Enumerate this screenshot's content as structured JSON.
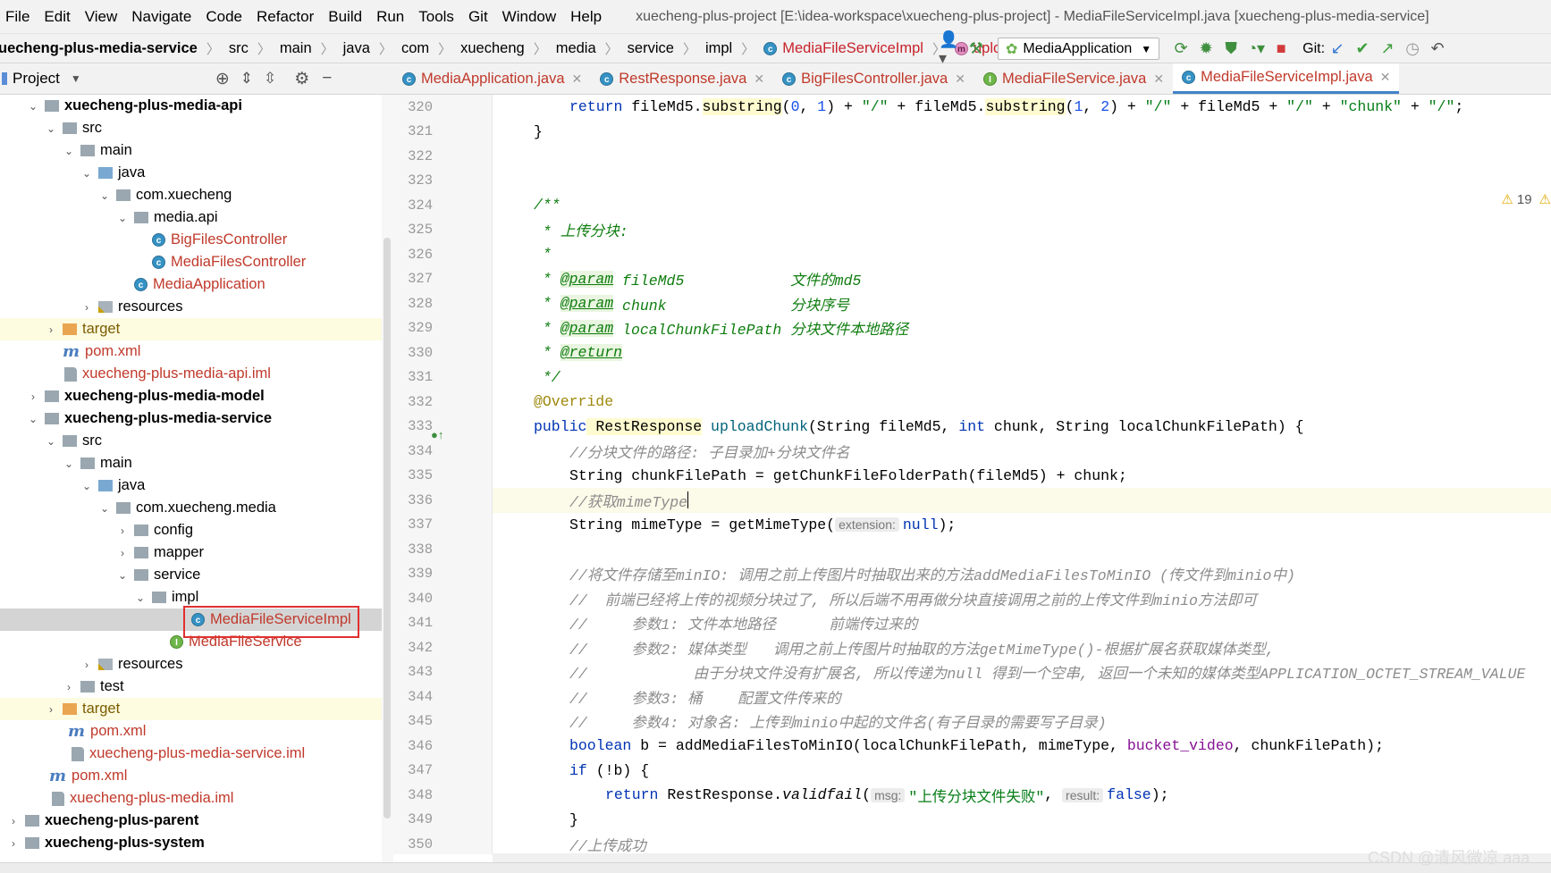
{
  "menubar": {
    "items": [
      "File",
      "Edit",
      "View",
      "Navigate",
      "Code",
      "Refactor",
      "Build",
      "Run",
      "Tools",
      "Git",
      "Window",
      "Help"
    ],
    "window_title": "xuecheng-plus-project [E:\\idea-workspace\\xuecheng-plus-project] - MediaFileServiceImpl.java [xuecheng-plus-media-service]"
  },
  "breadcrumb": {
    "items": [
      "uecheng-plus-media-service",
      "src",
      "main",
      "java",
      "com",
      "xuecheng",
      "media",
      "service",
      "impl",
      "MediaFileServiceImpl",
      "uploadChunk"
    ]
  },
  "toolbar": {
    "run_config": "MediaApplication",
    "git_label": "Git:"
  },
  "sidebar": {
    "title": "Project"
  },
  "tabs": [
    {
      "label": "MediaApplication.java",
      "icon": "class-icon"
    },
    {
      "label": "RestResponse.java",
      "icon": "class-icon"
    },
    {
      "label": "BigFilesController.java",
      "icon": "class-icon"
    },
    {
      "label": "MediaFileService.java",
      "icon": "interface-icon"
    },
    {
      "label": "MediaFileServiceImpl.java",
      "icon": "class-icon",
      "active": true
    }
  ],
  "tree": {
    "r0": "xuecheng-plus-media-api",
    "r1": "src",
    "r2": "main",
    "r3": "java",
    "r4": "com.xuecheng",
    "r5": "media.api",
    "r6": "BigFilesController",
    "r7": "MediaFilesController",
    "r8": "MediaApplication",
    "r9": "resources",
    "r10": "target",
    "r11": "pom.xml",
    "r12": "xuecheng-plus-media-api.iml",
    "r13": "xuecheng-plus-media-model",
    "r14": "xuecheng-plus-media-service",
    "r15": "src",
    "r16": "main",
    "r17": "java",
    "r18": "com.xuecheng.media",
    "r19": "config",
    "r20": "mapper",
    "r21": "service",
    "r22": "impl",
    "r23": "MediaFileServiceImpl",
    "r24": "MediaFileService",
    "r25": "resources",
    "r26": "test",
    "r27": "target",
    "r28": "pom.xml",
    "r29": "xuecheng-plus-media-service.iml",
    "r30": "pom.xml",
    "r31": "xuecheng-plus-media.iml",
    "r32": "xuecheng-plus-parent",
    "r33": "xuecheng-plus-system"
  },
  "editor": {
    "line_numbers": [
      "320",
      "321",
      "322",
      "323",
      "324",
      "325",
      "326",
      "327",
      "328",
      "329",
      "330",
      "331",
      "332",
      "333",
      "334",
      "335",
      "336",
      "337",
      "338",
      "339",
      "340",
      "341",
      "342",
      "343",
      "344",
      "345",
      "346",
      "347",
      "348",
      "349",
      "350"
    ],
    "warnings": "19",
    "code": {
      "l320a": "return",
      "l320b": " fileMd5.",
      "l320c": "substring",
      "l320d": "(",
      "l320e": "0",
      "l320f": ", ",
      "l320g": "1",
      "l320h": ") + ",
      "l320i": "\"/\"",
      "l320j": " + fileMd5.",
      "l320k": "substring",
      "l320l": "(",
      "l320m": "1",
      "l320n": ", ",
      "l320o": "2",
      "l320p": ") + ",
      "l320q": "\"/\"",
      "l320r": " + fileMd5 + ",
      "l320s": "\"/\"",
      "l320t": " + ",
      "l320u": "\"chunk\"",
      "l320v": " + ",
      "l320w": "\"/\"",
      "l320x": ";",
      "l321": "}",
      "l324": "/**",
      "l325": " * 上传分块:",
      "l326": " *",
      "l327a": " * ",
      "l327b": "@param",
      "l327c": " fileMd5            文件的md5",
      "l328a": " * ",
      "l328b": "@param",
      "l328c": " chunk              分块序号",
      "l329a": " * ",
      "l329b": "@param",
      "l329c": " localChunkFilePath 分块文件本地路径",
      "l330a": " * ",
      "l330b": "@return",
      "l331": " */",
      "l332": "@Override",
      "l333a": "public",
      "l333b": " RestResponse",
      "l333c": " uploadChunk",
      "l333d": "(String fileMd5, ",
      "l333e": "int",
      "l333f": " chunk, String localChunkFilePath) {",
      "l334": "//分块文件的路径: 子目录加+分块文件名",
      "l335a": "String chunkFilePath = getChunkFileFolderPath(fileMd5) + chunk;",
      "l336": "//获取mimeType",
      "l337a": "String mimeType = getMimeType(",
      "l337b": "extension:",
      "l337c": "null",
      "l337d": ");",
      "l339": "//将文件存储至minIO: 调用之前上传图片时抽取出来的方法addMediaFilesToMinIO (传文件到minio中)",
      "l340": "//  前端已经将上传的视频分块过了, 所以后端不用再做分块直接调用之前的上传文件到minio方法即可",
      "l341": "//     参数1: 文件本地路径      前端传过来的",
      "l342": "//     参数2: 媒体类型   调用之前上传图片时抽取的方法getMimeType()-根据扩展名获取媒体类型,",
      "l343": "//            由于分块文件没有扩展名, 所以传递为null 得到一个空串, 返回一个未知的媒体类型APPLICATION_OCTET_STREAM_VALUE",
      "l344": "//     参数3: 桶    配置文件传来的",
      "l345": "//     参数4: 对象名: 上传到minio中起的文件名(有子目录的需要写子目录)",
      "l346a": "boolean",
      "l346b": " b = addMediaFilesToMinIO(localChunkFilePath, mimeType, ",
      "l346c": "bucket_video",
      "l346d": ", chunkFilePath);",
      "l347a": "if",
      "l347b": " (!b) {",
      "l348a": "return",
      "l348b": " RestResponse.",
      "l348c": "validfail",
      "l348d": "(",
      "l348e": "msg:",
      "l348f": "\"上传分块文件失败\"",
      "l348g": ", ",
      "l348h": "result:",
      "l348i": "false",
      "l348j": ");",
      "l349": "}",
      "l350": "//上传成功"
    }
  },
  "watermark": "CSDN @清风微凉 aaa",
  "colors": {
    "accent": "#4083c9",
    "highlight_box": "#e03030",
    "keyword": "#0033b3",
    "string": "#067d17"
  }
}
